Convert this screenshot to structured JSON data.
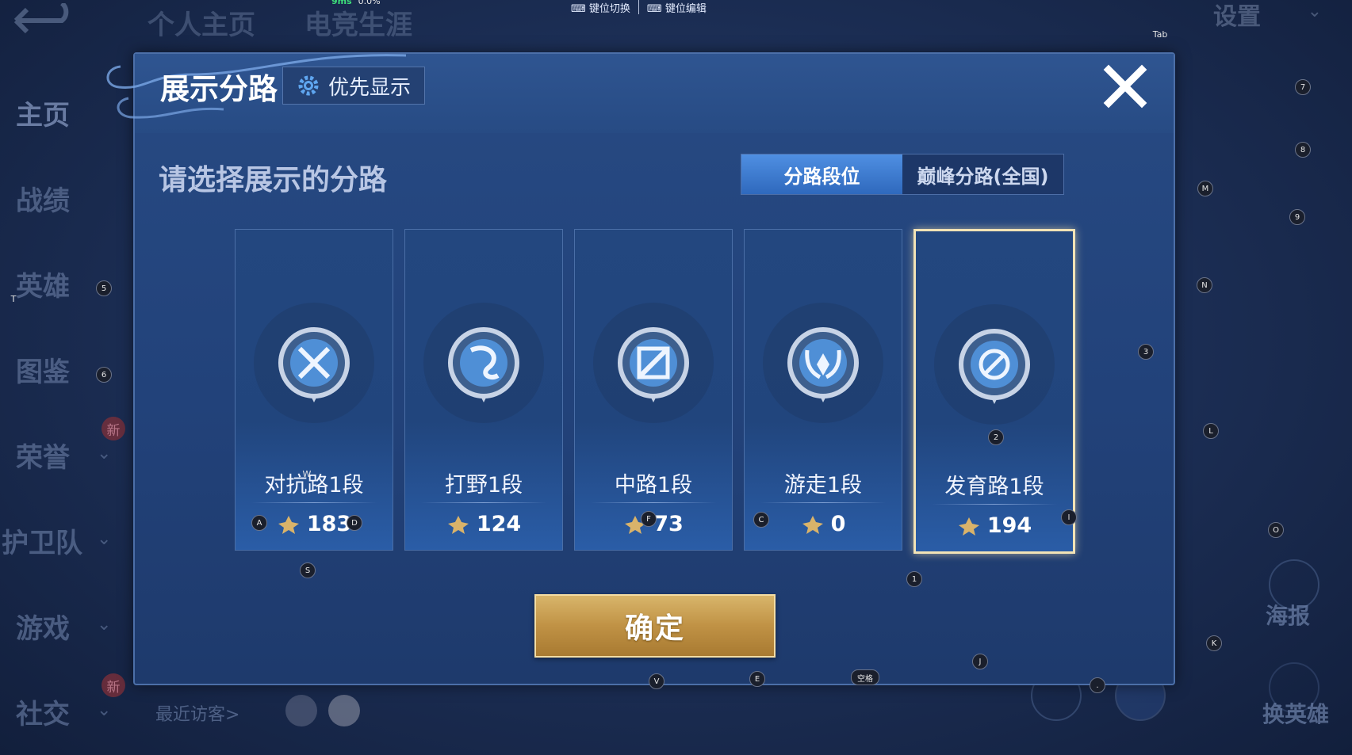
{
  "background": {
    "top_tabs": [
      "个人主页",
      "电竞生涯"
    ],
    "settings_label": "设置",
    "nav_items": [
      {
        "label": "主页",
        "new": false,
        "chevron": false,
        "active": true
      },
      {
        "label": "战绩",
        "new": false,
        "chevron": false,
        "active": false
      },
      {
        "label": "英雄",
        "new": false,
        "chevron": false,
        "active": false
      },
      {
        "label": "图鉴",
        "new": false,
        "chevron": false,
        "active": false
      },
      {
        "label": "荣誉",
        "new": true,
        "chevron": true,
        "active": false
      },
      {
        "label": "护卫队",
        "new": false,
        "chevron": true,
        "active": false
      },
      {
        "label": "游戏",
        "new": false,
        "chevron": true,
        "active": false
      },
      {
        "label": "社交",
        "new": true,
        "chevron": true,
        "active": false
      }
    ],
    "new_badge": "新",
    "recent_visitors": "最近访客>",
    "poster_label": "海报",
    "switch_hero_label": "换英雄"
  },
  "overlay_toolbar": {
    "ping": "9ms",
    "loss": "0.0%",
    "items": [
      "键位切换",
      "键位编辑"
    ]
  },
  "dialog": {
    "title": "展示分路",
    "priority_button": "优先显示",
    "subtitle": "请选择展示的分路",
    "tabs": [
      {
        "label": "分路段位",
        "active": true
      },
      {
        "label": "巅峰分路(全国)",
        "active": false
      }
    ],
    "cards": [
      {
        "rank": "对抗路1段",
        "points": "183",
        "emblem": "sword-shield-icon",
        "selected": false
      },
      {
        "rank": "打野1段",
        "points": "124",
        "emblem": "dragon-icon",
        "selected": false
      },
      {
        "rank": "中路1段",
        "points": "73",
        "emblem": "staff-icon",
        "selected": false
      },
      {
        "rank": "游走1段",
        "points": "0",
        "emblem": "wings-icon",
        "selected": false
      },
      {
        "rank": "发育路1段",
        "points": "194",
        "emblem": "target-icon",
        "selected": true
      }
    ],
    "confirm_label": "确定"
  },
  "key_hints": [
    "Tab",
    "7",
    "8",
    "M",
    "9",
    "N",
    "3",
    "L",
    "O",
    "K",
    "T",
    "5",
    "6",
    "W",
    "A",
    "D",
    "F",
    "C",
    "I",
    "2",
    "S",
    "1",
    "V",
    "E",
    "空格",
    "J",
    "."
  ],
  "colors": {
    "accent_blue": "#3f7fd6",
    "gold": "#c9a35a",
    "selected_border": "#f2e3b6"
  }
}
